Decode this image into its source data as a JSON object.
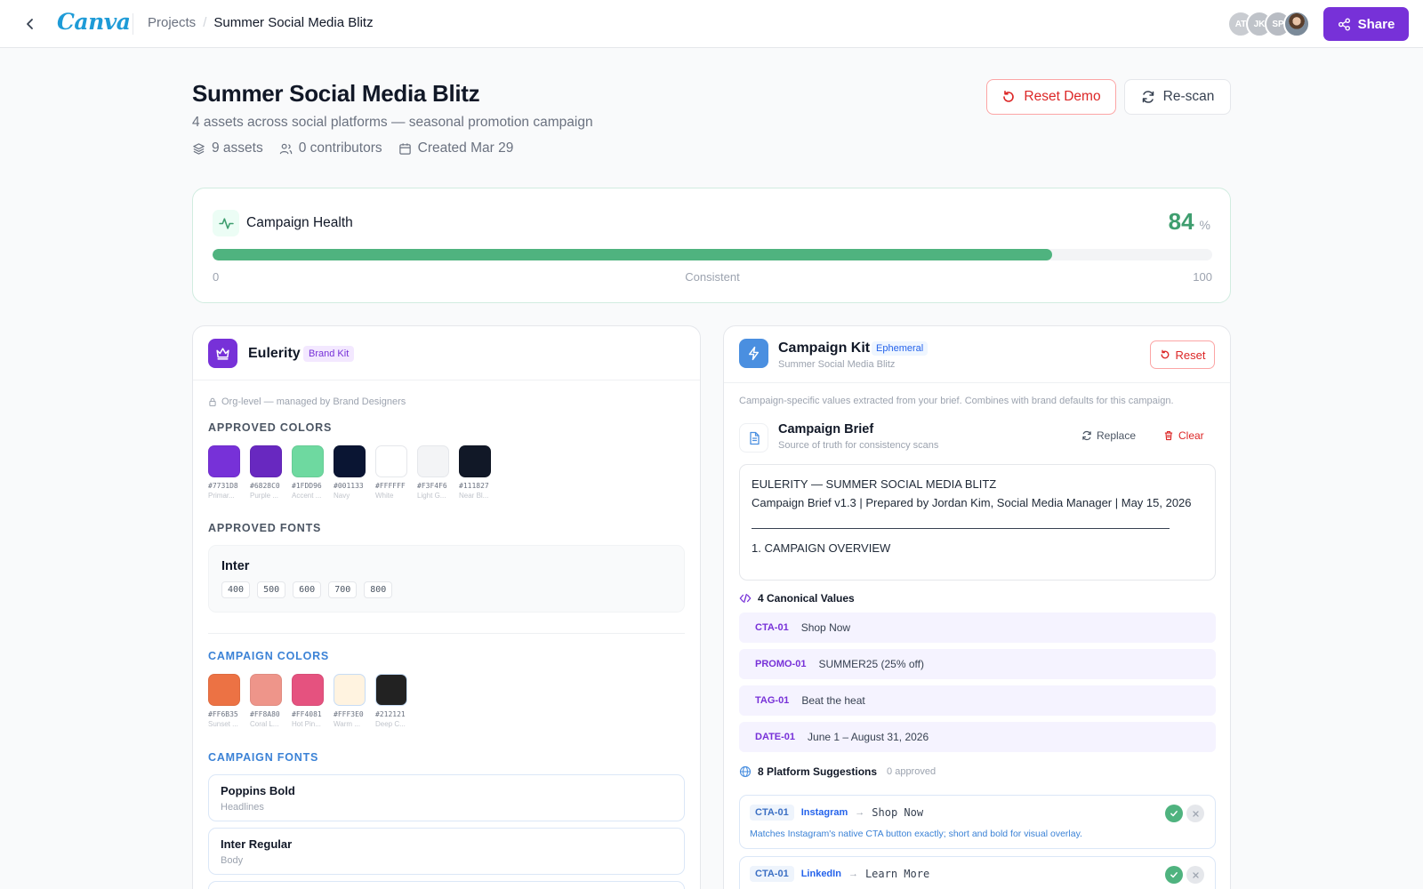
{
  "topbar": {
    "logo": "Canva",
    "breadcrumb_root": "Projects",
    "breadcrumb_sep": "/",
    "breadcrumb_current": "Summer Social Media Blitz",
    "avatars": [
      {
        "initials": "AT",
        "color": "#c9ccd1"
      },
      {
        "initials": "JK",
        "color": "#bfc3c9"
      },
      {
        "initials": "SP",
        "color": "#b8bcc3"
      },
      {
        "initials": "",
        "color": "#7b8a99"
      }
    ],
    "share_label": "Share",
    "accent": "#7731d8"
  },
  "header": {
    "title": "Summer Social Media Blitz",
    "subtitle": "4 assets across social platforms — seasonal promotion campaign",
    "assets": "9 assets",
    "contributors": "0 contributors",
    "created": "Created Mar 29",
    "reset_demo_label": "Reset Demo",
    "rescan_label": "Re-scan"
  },
  "health": {
    "title": "Campaign Health",
    "score": "84",
    "unit": "%",
    "progress": 84,
    "axis_min": "0",
    "axis_status": "Consistent",
    "axis_max": "100",
    "color": "#4fb37f"
  },
  "brand": {
    "name": "Eulerity",
    "badge": "Brand Kit",
    "org_note": "Org-level — managed by Brand Designers",
    "approved_colors_label": "APPROVED COLORS",
    "approved_colors": [
      {
        "hex": "#7731D8",
        "name": "Primar..."
      },
      {
        "hex": "#6828C0",
        "name": "Purple ..."
      },
      {
        "hex": "#1FDD96",
        "name": "Accent ..."
      },
      {
        "hex": "#001133",
        "name": "Navy"
      },
      {
        "hex": "#FFFFFF",
        "name": "White"
      },
      {
        "hex": "#F3F4F6",
        "name": "Light G..."
      },
      {
        "hex": "#111827",
        "name": "Near Bl..."
      }
    ],
    "approved_colors_display": [
      "#7731D8",
      "#6828C0",
      "#6ED9A0",
      "#0A1533",
      "#FFFFFF",
      "#F3F4F6",
      "#111827"
    ],
    "approved_fonts_label": "APPROVED FONTS",
    "font_name": "Inter",
    "font_weights": [
      "400",
      "500",
      "600",
      "700",
      "800"
    ],
    "campaign_colors_label": "CAMPAIGN COLORS",
    "campaign_colors": [
      {
        "hex": "#FF6B35",
        "name": "Sunset ..."
      },
      {
        "hex": "#FF8A80",
        "name": "Coral L..."
      },
      {
        "hex": "#FF4081",
        "name": "Hot Pin..."
      },
      {
        "hex": "#FFF3E0",
        "name": "Warm ..."
      },
      {
        "hex": "#212121",
        "name": "Deep C..."
      }
    ],
    "campaign_colors_display": [
      "#EC7244",
      "#EE958A",
      "#E5527F",
      "#FFF3E0",
      "#222222"
    ],
    "campaign_fonts_label": "CAMPAIGN FONTS",
    "campaign_fonts": [
      {
        "name": "Poppins Bold",
        "role": "Headlines"
      },
      {
        "name": "Inter Regular",
        "role": "Body"
      }
    ]
  },
  "kit": {
    "name": "Campaign Kit",
    "badge": "Ephemeral",
    "subtitle": "Summer Social Media Blitz",
    "reset_label": "Reset",
    "description": "Campaign-specific values extracted from your brief. Combines with brand defaults for this campaign.",
    "brief_title": "Campaign Brief",
    "brief_subtitle": "Source of truth for consistency scans",
    "replace_label": "Replace",
    "clear_label": "Clear",
    "brief_line1": "EULERITY — SUMMER SOCIAL MEDIA BLITZ",
    "brief_line2": "Campaign Brief v1.3 | Prepared by Jordan Kim, Social Media Manager | May 15, 2026",
    "brief_section": "1. CAMPAIGN OVERVIEW",
    "values_label": "4 Canonical Values",
    "values": [
      {
        "tag": "CTA-01",
        "value": "Shop Now"
      },
      {
        "tag": "PROMO-01",
        "value": "SUMMER25 (25% off)"
      },
      {
        "tag": "TAG-01",
        "value": "Beat the heat"
      },
      {
        "tag": "DATE-01",
        "value": "June 1 – August 31, 2026"
      }
    ],
    "suggestions_label": "8 Platform Suggestions",
    "suggestions_approved": "0 approved",
    "suggestions": [
      {
        "tag": "CTA-01",
        "platform": "Instagram",
        "arrow": "→",
        "value": "Shop Now",
        "reason": "Matches Instagram's native CTA button exactly; short and bold for visual overlay."
      },
      {
        "tag": "CTA-01",
        "platform": "LinkedIn",
        "arrow": "→",
        "value": "Learn More",
        "reason": ""
      }
    ]
  }
}
